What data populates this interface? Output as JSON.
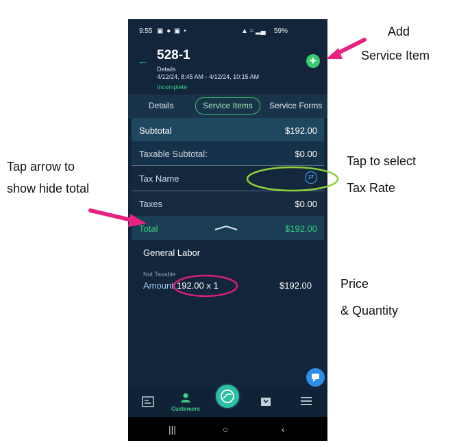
{
  "status_bar": {
    "time": "9:55",
    "battery": "59%"
  },
  "header": {
    "title": "528-1",
    "subtitle": "Details",
    "date_range": "4/12/24, 8:45 AM - 4/12/24, 10:15 AM",
    "status": "Incomplete"
  },
  "tabs": [
    {
      "label": "Details"
    },
    {
      "label": "Service Items",
      "selected": true
    },
    {
      "label": "Service Forms"
    }
  ],
  "summary": {
    "subtotal_label": "Subtotal",
    "subtotal_value": "$192.00",
    "taxable_subtotal_label": "Taxable Subtotal:",
    "taxable_subtotal_value": "$0.00",
    "tax_name_label": "Tax Name",
    "taxes_label": "Taxes",
    "taxes_value": "$0.00",
    "total_label": "Total",
    "total_value": "$192.00"
  },
  "service_item": {
    "name": "General Labor",
    "tax_status": "Not Taxable",
    "amount_label": "Amount:",
    "amount_value": "192.00 x 1",
    "amount_total": "$192.00"
  },
  "bottom_nav": {
    "customers_label": "Customers"
  },
  "annotations": {
    "add": "Add",
    "service_item": "Service Item",
    "tap_to_select": "Tap to select",
    "tax_rate": "Tax Rate",
    "tap_arrow": "Tap arrow to",
    "show_hide": "show hide total",
    "price": "Price",
    "quantity": "& Quantity"
  },
  "colors": {
    "app_background": "#13253a",
    "accent_green": "#39cc6f",
    "annotation_pink": "#e8237f",
    "annotation_green": "#8ed13a",
    "info_blue": "#2f8fe8"
  },
  "icons": {
    "back": "back-arrow-icon",
    "add": "plus-icon",
    "tax_rate": "swap-icon",
    "collapse": "chevron-up-icon",
    "chat": "chat-icon",
    "reports": "reports-icon",
    "customers": "person-icon",
    "fab": "route-icon",
    "map": "map-icon",
    "menu": "menu-icon"
  }
}
